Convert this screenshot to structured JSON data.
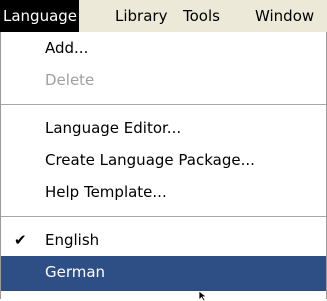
{
  "menubar": {
    "items": [
      {
        "label": "Language"
      },
      {
        "label": "Library"
      },
      {
        "label": "Tools"
      },
      {
        "label": "Window"
      }
    ]
  },
  "menu": {
    "add": "Add...",
    "delete": "Delete",
    "language_editor": "Language Editor...",
    "create_package": "Create Language Package...",
    "help_template": "Help Template...",
    "english": "English",
    "german": "German",
    "check_glyph": "✔"
  },
  "colors": {
    "selection": "#2d4f86",
    "menubar_bg": "#ece9d8",
    "active_menu_bg": "#000000"
  }
}
